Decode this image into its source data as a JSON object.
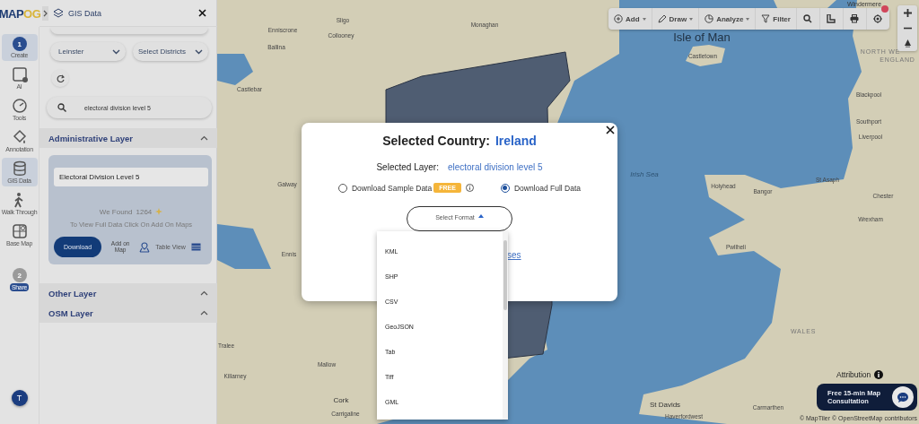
{
  "logo": {
    "main": "MAP",
    "accent": "OG"
  },
  "rail": {
    "items": [
      {
        "kind": "step",
        "step": "1",
        "label": "Create",
        "selected": true
      },
      {
        "kind": "tool",
        "label": "AI",
        "selected": false
      },
      {
        "kind": "tool",
        "label": "Tools",
        "selected": false
      },
      {
        "kind": "tool",
        "label": "Annotation",
        "selected": false
      },
      {
        "kind": "tool",
        "label": "GIS Data",
        "selected": true
      },
      {
        "kind": "tool",
        "label": "Walk Through",
        "selected": false
      },
      {
        "kind": "tool",
        "label": "Base Map",
        "selected": false
      },
      {
        "kind": "step",
        "step": "2",
        "label": "Share",
        "selected": false
      }
    ],
    "avatar": "T"
  },
  "panel": {
    "title": "GIS Data",
    "region": "Leinster",
    "districts": "Select Districts",
    "search": "electoral division level 5",
    "sections": [
      {
        "title": "Administrative Layer",
        "layer": "Electoral Division Level 5",
        "found_label": "We Found",
        "count": "1264",
        "hint": "To View Full Data Click On Add On Maps",
        "download": "Download",
        "add_on_map": "Add on Map",
        "table_view": "Table View"
      },
      {
        "title": "Other Layer"
      },
      {
        "title": "OSM Layer"
      }
    ]
  },
  "toolbar": [
    {
      "kind": "menu",
      "label": "Add"
    },
    {
      "kind": "menu",
      "label": "Draw"
    },
    {
      "kind": "menu",
      "label": "Analyze"
    },
    {
      "kind": "button",
      "label": "Filter"
    }
  ],
  "map_labels": [
    {
      "kind": "town",
      "text": "Sligo"
    },
    {
      "kind": "town",
      "text": "Enniscrone"
    },
    {
      "kind": "town",
      "text": "Collooney"
    },
    {
      "kind": "town",
      "text": "Ballina"
    },
    {
      "kind": "town",
      "text": "Monaghan"
    },
    {
      "kind": "town",
      "text": "Castlebar"
    },
    {
      "kind": "town",
      "text": "Galway"
    },
    {
      "kind": "island",
      "text": "Isle of Man"
    },
    {
      "kind": "town",
      "text": "Castletown"
    },
    {
      "kind": "town",
      "text": "Windermere"
    },
    {
      "kind": "region",
      "text": "NORTH WE"
    },
    {
      "kind": "region",
      "text": "ENGLAND"
    },
    {
      "kind": "town",
      "text": "Blackpool"
    },
    {
      "kind": "town",
      "text": "Southport"
    },
    {
      "kind": "town",
      "text": "Liverpool"
    },
    {
      "kind": "sea",
      "text": "Irish Sea"
    },
    {
      "kind": "town",
      "text": "Holyhead"
    },
    {
      "kind": "town",
      "text": "Bangor"
    },
    {
      "kind": "town",
      "text": "St Asaph"
    },
    {
      "kind": "town",
      "text": "Chester"
    },
    {
      "kind": "town",
      "text": "Wrexham"
    },
    {
      "kind": "town",
      "text": "Pwllheli"
    },
    {
      "kind": "region",
      "text": "WALES"
    },
    {
      "kind": "town",
      "text": "Ennis"
    },
    {
      "kind": "town",
      "text": "Tralee"
    },
    {
      "kind": "town",
      "text": "Killarney"
    },
    {
      "kind": "town",
      "text": "Mallow"
    },
    {
      "kind": "city",
      "text": "Cork"
    },
    {
      "kind": "town",
      "text": "Carrigaline"
    },
    {
      "kind": "city",
      "text": "St Davids"
    },
    {
      "kind": "town",
      "text": "Haverfordwest"
    },
    {
      "kind": "town",
      "text": "Carmarthen"
    }
  ],
  "attribution": {
    "label": "Attribution",
    "credits": "© MapTiler © OpenStreetMap contributors"
  },
  "consultation": "Free 15-min Map Consultation",
  "modal": {
    "country_label": "Selected Country:",
    "country": "Ireland",
    "layer_label": "Selected Layer:",
    "layer": "electoral division level 5",
    "options": [
      {
        "label": "Download Sample Data",
        "badge": "FREE",
        "selected": false
      },
      {
        "label": "Download Full Data",
        "selected": true
      }
    ],
    "format_placeholder": "Select Format",
    "link_fragment": "ses",
    "format_options": [
      "KML",
      "SHP",
      "CSV",
      "GeoJSON",
      "Tab",
      "Tiff",
      "GML"
    ]
  }
}
